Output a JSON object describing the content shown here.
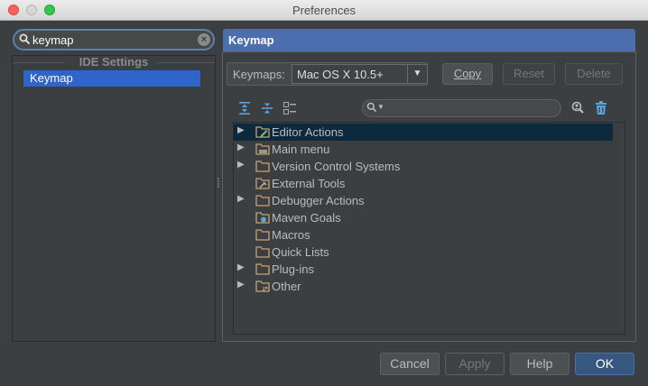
{
  "window": {
    "title": "Preferences"
  },
  "search": {
    "value": "keymap"
  },
  "sidebar": {
    "group_title": "IDE Settings",
    "items": [
      {
        "label": "Keymap",
        "selected": true
      }
    ]
  },
  "header": {
    "title": "Keymap"
  },
  "keymaps": {
    "label": "Keymaps:",
    "selected": "Mac OS X 10.5+",
    "copy": "Copy",
    "reset": "Reset",
    "delete": "Delete"
  },
  "tree": {
    "items": [
      {
        "label": "Editor Actions",
        "expandable": true,
        "icon": "folder-edit-icon",
        "selected": true
      },
      {
        "label": "Main menu",
        "expandable": true,
        "icon": "folder-menu-icon"
      },
      {
        "label": "Version Control Systems",
        "expandable": true,
        "icon": "folder-icon"
      },
      {
        "label": "External Tools",
        "expandable": false,
        "icon": "folder-tools-icon"
      },
      {
        "label": "Debugger Actions",
        "expandable": true,
        "icon": "folder-icon"
      },
      {
        "label": "Maven Goals",
        "expandable": false,
        "icon": "folder-maven-icon"
      },
      {
        "label": "Macros",
        "expandable": false,
        "icon": "folder-icon"
      },
      {
        "label": "Quick Lists",
        "expandable": false,
        "icon": "folder-icon"
      },
      {
        "label": "Plug-ins",
        "expandable": true,
        "icon": "folder-icon"
      },
      {
        "label": "Other",
        "expandable": true,
        "icon": "folder-other-icon"
      }
    ]
  },
  "footer": {
    "cancel": "Cancel",
    "apply": "Apply",
    "help": "Help",
    "ok": "OK"
  },
  "colors": {
    "background": "#3c3f41",
    "accent": "#4b6eaf",
    "selection": "#2f65ca",
    "tree_selection": "#0d293e",
    "folder": "#c9a26b"
  }
}
